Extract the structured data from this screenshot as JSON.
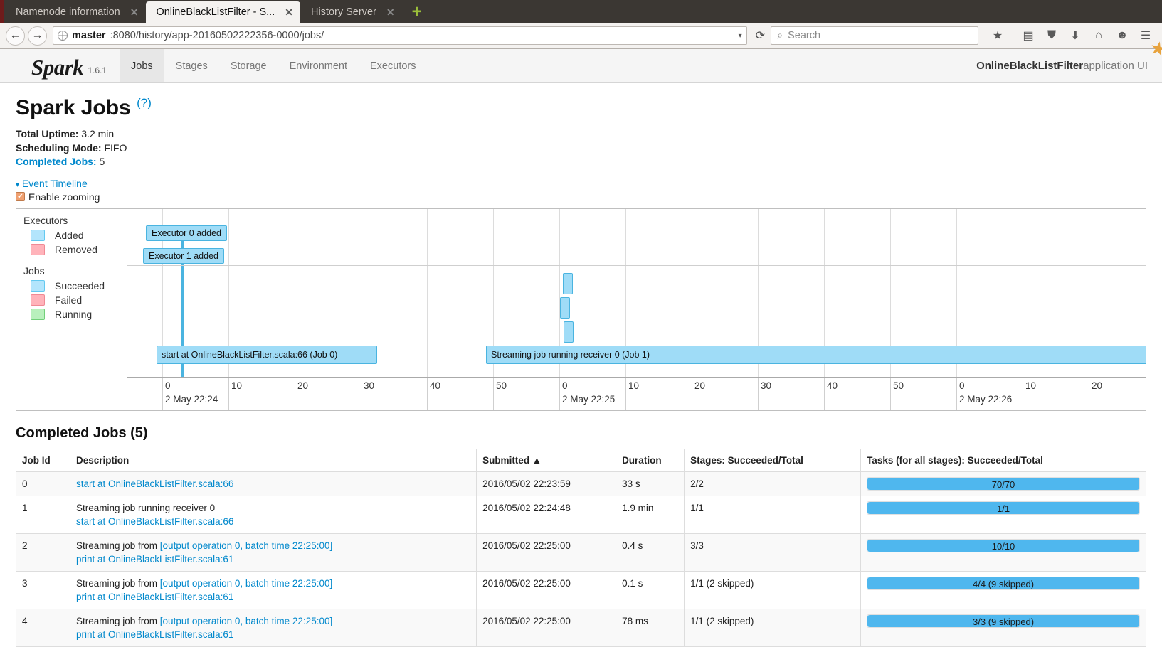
{
  "browser": {
    "tabs": [
      {
        "title": "Namenode information",
        "active": false,
        "close": "✕"
      },
      {
        "title": "OnlineBlackListFilter - S...",
        "active": true,
        "close": "✕"
      },
      {
        "title": "History Server",
        "active": false,
        "close": "✕"
      }
    ],
    "new_tab_label": "+",
    "back_icon": "←",
    "forward_icon": "→",
    "url_host": "master",
    "url_path": ":8080/history/app-20160502222356-0000/jobs/",
    "url_dropdown_icon": "▾",
    "reload_icon": "⟳",
    "search_placeholder": "Search",
    "search_icon": "⌕",
    "toolbar_icons": [
      "★",
      "▤",
      "⛊",
      "⬇",
      "⌂",
      "☻",
      "☰"
    ]
  },
  "spark": {
    "logo_text": "Spark",
    "version": "1.6.1",
    "nav": [
      {
        "label": "Jobs",
        "active": true
      },
      {
        "label": "Stages",
        "active": false
      },
      {
        "label": "Storage",
        "active": false
      },
      {
        "label": "Environment",
        "active": false
      },
      {
        "label": "Executors",
        "active": false
      }
    ],
    "app_name": "OnlineBlackListFilter",
    "app_suffix": " application UI"
  },
  "page": {
    "title": "Spark Jobs",
    "help_icon": "(?)",
    "total_uptime_label": "Total Uptime:",
    "total_uptime_value": " 3.2 min",
    "scheduling_mode_label": "Scheduling Mode:",
    "scheduling_mode_value": " FIFO",
    "completed_jobs_label": "Completed Jobs:",
    "completed_jobs_value": " 5",
    "event_timeline_label": "Event Timeline",
    "event_timeline_caret": "▾",
    "enable_zooming_label": "Enable zooming",
    "checkbox_glyph": "✔"
  },
  "timeline": {
    "legend": {
      "executors_title": "Executors",
      "executors_items": [
        {
          "label": "Added",
          "color": "#b3e5fc"
        },
        {
          "label": "Removed",
          "color": "#ffb3ba"
        }
      ],
      "jobs_title": "Jobs",
      "jobs_items": [
        {
          "label": "Succeeded",
          "color": "#b3e5fc"
        },
        {
          "label": "Failed",
          "color": "#ffb3ba"
        },
        {
          "label": "Running",
          "color": "#b9f0bd"
        }
      ]
    },
    "events": [
      {
        "label": "Executor 0 added",
        "type": "executor-added"
      },
      {
        "label": "Executor 1 added",
        "type": "executor-added"
      }
    ],
    "job_bars": [
      {
        "label": "start at OnlineBlackListFilter.scala:66 (Job 0)"
      },
      {
        "label": "Streaming job running receiver 0 (Job 1)"
      }
    ],
    "axis": {
      "ticks": [
        "0",
        "10",
        "20",
        "30",
        "40",
        "50",
        "0",
        "10",
        "20",
        "30",
        "40",
        "50",
        "0",
        "10",
        "20"
      ],
      "date_labels": [
        "2 May 22:24",
        "2 May 22:25",
        "2 May 22:26"
      ]
    }
  },
  "jobs_table": {
    "section_title": "Completed Jobs (5)",
    "columns": [
      "Job Id",
      "Description",
      "Submitted ▲",
      "Duration",
      "Stages: Succeeded/Total",
      "Tasks (for all stages): Succeeded/Total"
    ],
    "rows": [
      {
        "job_id": "0",
        "desc_plain": "",
        "desc_link": "start at OnlineBlackListFilter.scala:66",
        "desc_line2": "",
        "submitted": "2016/05/02 22:23:59",
        "duration": "33 s",
        "stages": "2/2",
        "tasks_text": "70/70",
        "tasks_pct": 100
      },
      {
        "job_id": "1",
        "desc_plain": "Streaming job running receiver 0",
        "desc_link": "",
        "desc_line2": "start at OnlineBlackListFilter.scala:66",
        "submitted": "2016/05/02 22:24:48",
        "duration": "1.9 min",
        "stages": "1/1",
        "tasks_text": "1/1",
        "tasks_pct": 100
      },
      {
        "job_id": "2",
        "desc_plain": "Streaming job from ",
        "desc_link": "[output operation 0, batch time 22:25:00]",
        "desc_line2": "print at OnlineBlackListFilter.scala:61",
        "submitted": "2016/05/02 22:25:00",
        "duration": "0.4 s",
        "stages": "3/3",
        "tasks_text": "10/10",
        "tasks_pct": 100
      },
      {
        "job_id": "3",
        "desc_plain": "Streaming job from ",
        "desc_link": "[output operation 0, batch time 22:25:00]",
        "desc_line2": "print at OnlineBlackListFilter.scala:61",
        "submitted": "2016/05/02 22:25:00",
        "duration": "0.1 s",
        "stages": "1/1 (2 skipped)",
        "tasks_text": "4/4 (9 skipped)",
        "tasks_pct": 100
      },
      {
        "job_id": "4",
        "desc_plain": "Streaming job from ",
        "desc_link": "[output operation 0, batch time 22:25:00]",
        "desc_line2": "print at OnlineBlackListFilter.scala:61",
        "submitted": "2016/05/02 22:25:00",
        "duration": "78 ms",
        "stages": "1/1 (2 skipped)",
        "tasks_text": "3/3 (9 skipped)",
        "tasks_pct": 100
      }
    ]
  },
  "colors": {
    "accent_link": "#0088cc",
    "bar_fill": "#4fb7ee",
    "timeline_blue": "#9fdcf7",
    "timeline_blue_border": "#4ab4e0",
    "legend_red": "#ffb3ba",
    "legend_green": "#b9f0bd"
  }
}
